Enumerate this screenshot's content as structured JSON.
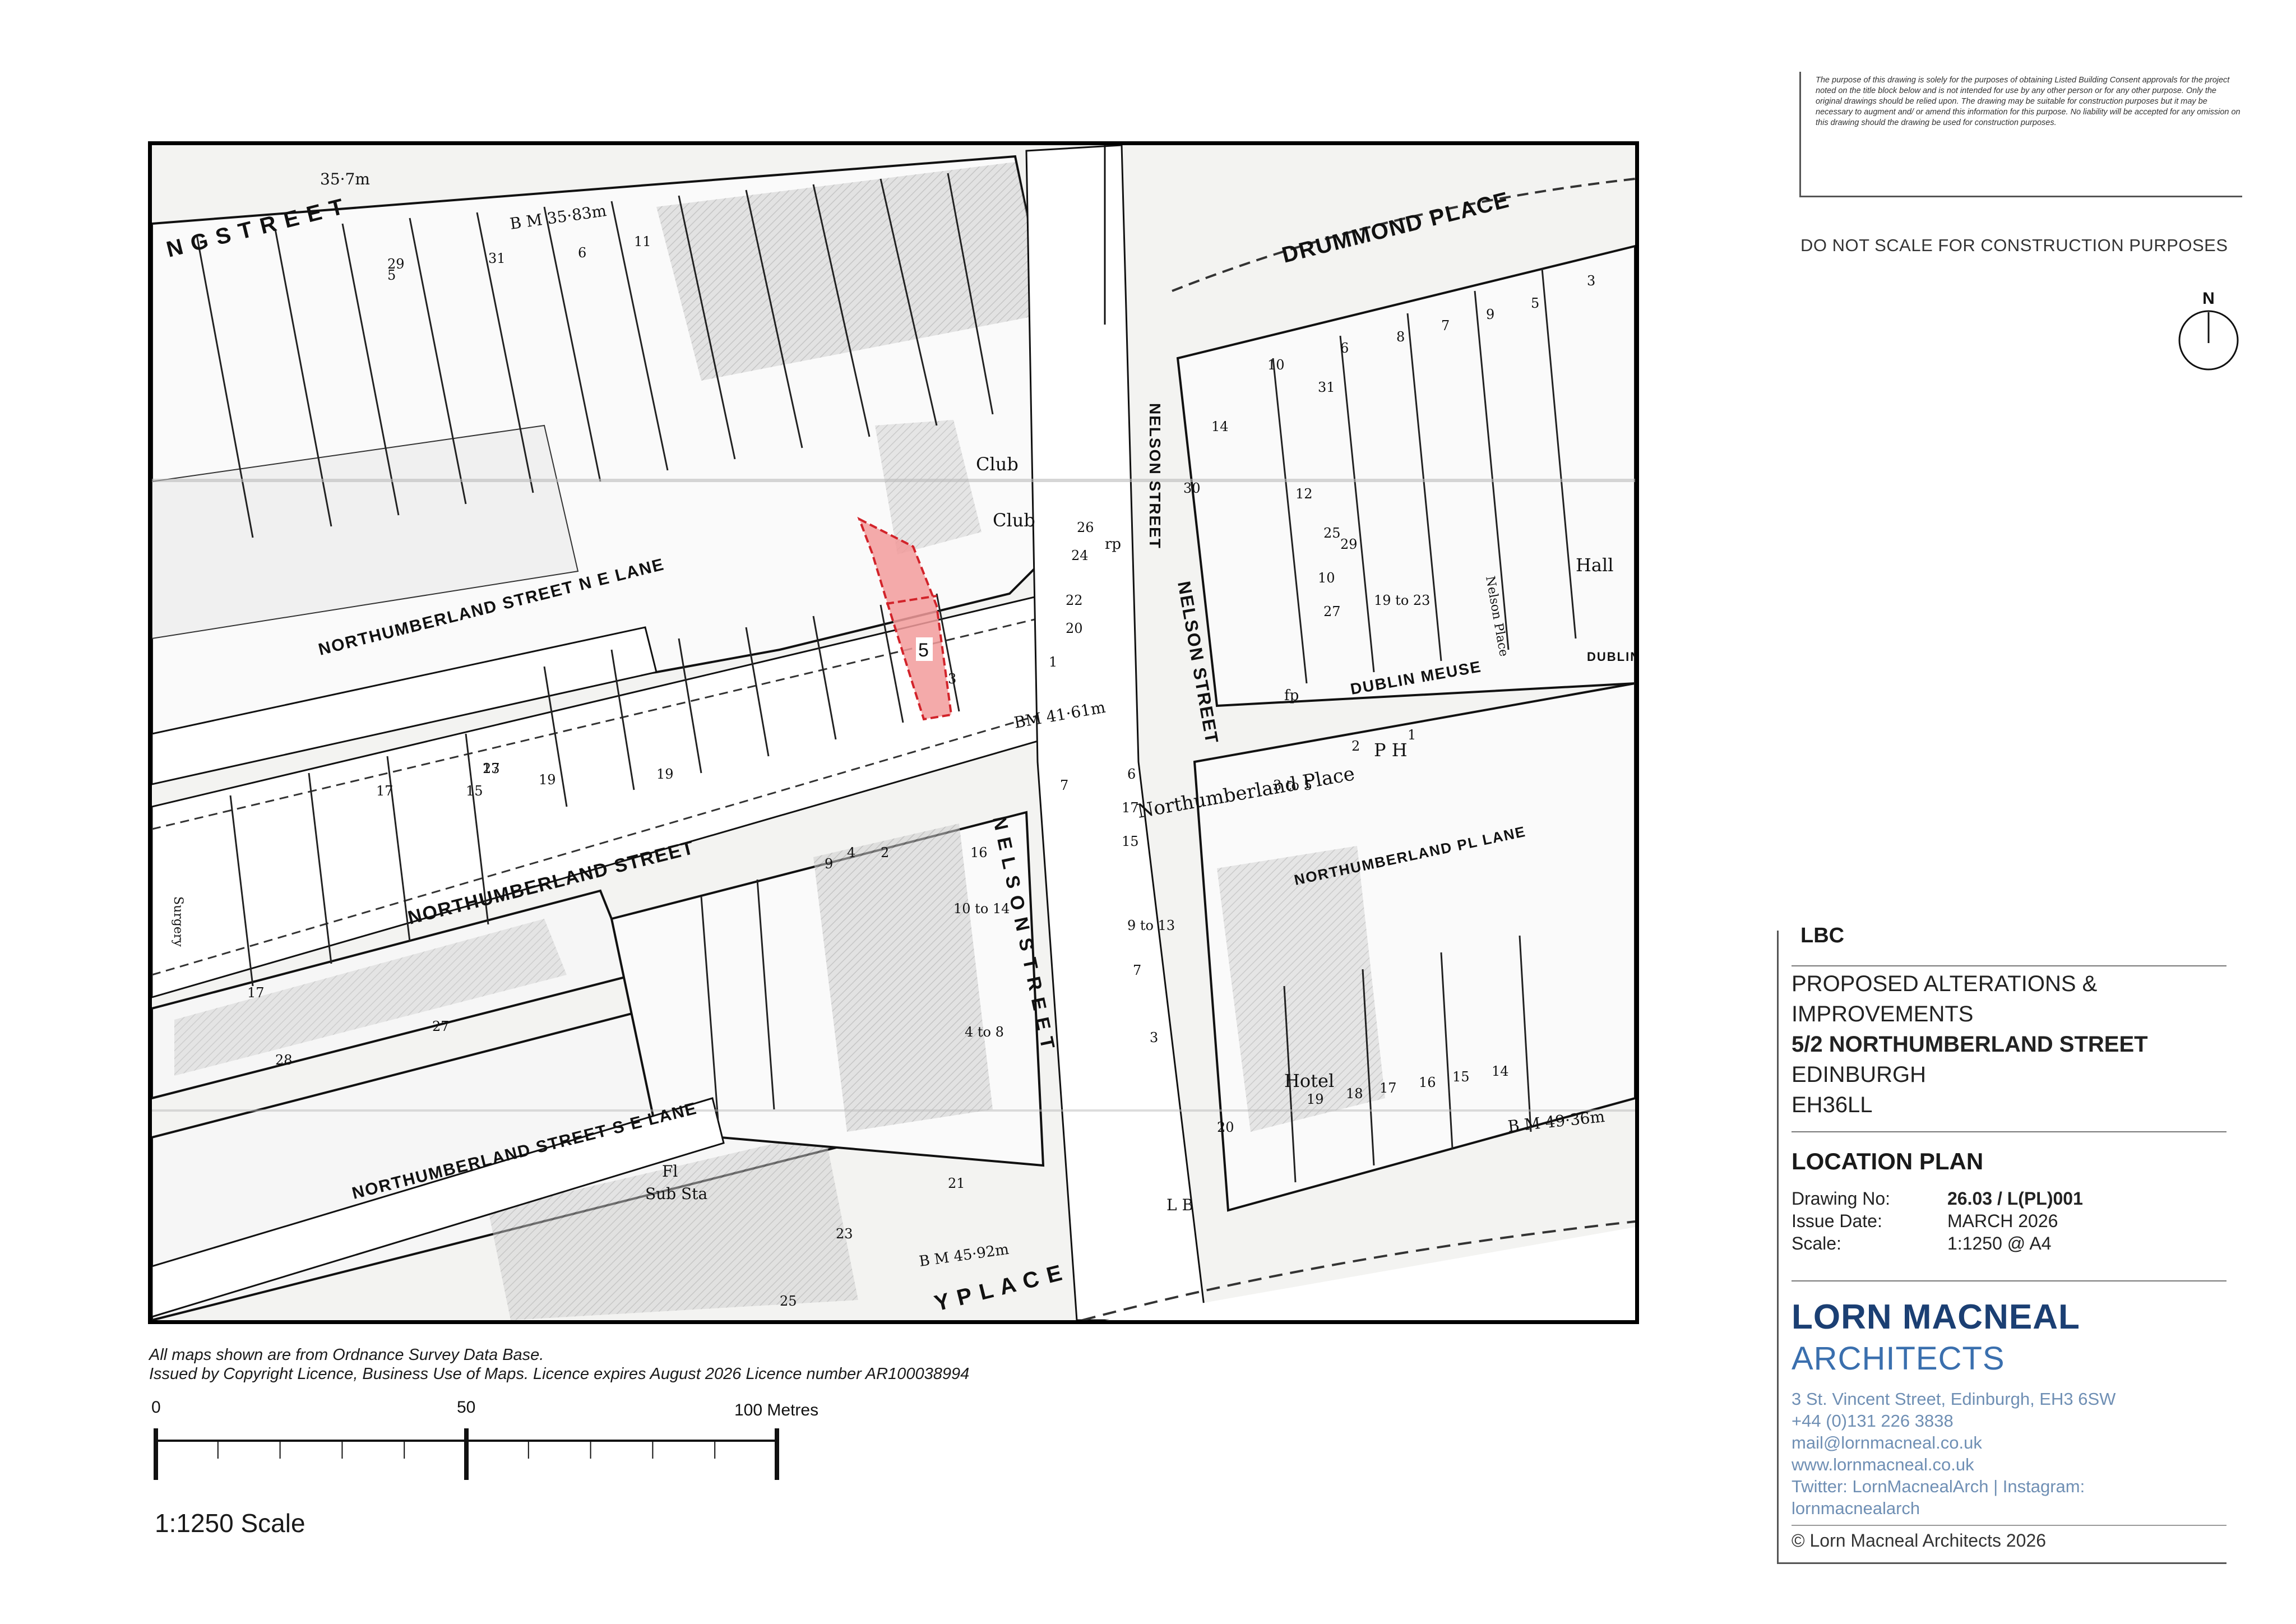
{
  "disclaimer": "The purpose of this drawing is solely for the purposes of obtaining Listed Building Consent approvals for the project noted on the title block below and is not intended for use by any other person or for any other purpose. Only the original drawings should be relied upon. The drawing may be suitable for construction purposes but it may be necessary to augment and/ or amend this information for this purpose. No liability will be accepted for any omission on this drawing should the drawing be used for construction purposes.",
  "no_scale_note": "DO NOT SCALE FOR CONSTRUCTION PURPOSES",
  "north_label": "N",
  "title_block": {
    "submission": "LBC",
    "project_lines": [
      "PROPOSED ALTERATIONS &",
      "IMPROVEMENTS"
    ],
    "address_bold": "5/2 NORTHUMBERLAND STREET",
    "address_lines": [
      "EDINBURGH",
      "EH36LL"
    ],
    "drawing_title": "LOCATION PLAN",
    "meta": [
      {
        "label": "Drawing No:",
        "value": "26.03 / L(PL)001"
      },
      {
        "label": "Issue Date:",
        "value": "MARCH 2026"
      },
      {
        "label": "Scale:",
        "value": "1:1250 @ A4"
      }
    ],
    "firm_name_1": "LORN MACNEAL",
    "firm_name_2": "ARCHITECTS",
    "contact": [
      "3 St. Vincent Street, Edinburgh, EH3 6SW",
      "+44 (0)131 226 3838",
      "mail@lornmacneal.co.uk",
      "www.lornmacneal.co.uk",
      "Twitter: LornMacnealArch | Instagram:",
      "lornmacnealarch"
    ],
    "copyright": "© Lorn Macneal Architects 2026",
    "firm_color": "#1b3f73",
    "firm_color_light": "#3a6fae"
  },
  "map_note": [
    "All maps shown are from Ordnance Survey Data Base.",
    "Issued by Copyright Licence, Business Use of Maps. Licence expires August 2026 Licence number AR100038994"
  ],
  "scale_bar": {
    "labels": [
      "0",
      "50",
      "100 Metres"
    ],
    "caption": "1:1250 Scale"
  },
  "map": {
    "site_number": "5",
    "site_color": "#f29b9b",
    "streets": {
      "northumberland_street": "NORTHUMBERLAND STREET",
      "northumberland_ne_lane": "NORTHUMBERLAND STREET N E LANE",
      "northumberland_se_lane": "NORTHUMBERLAND STREET S E LANE",
      "nelson_street": "NELSON STREET",
      "nelson_street_north": "NELSON STREET",
      "nelson_street_south": "N E L S O N   S T R E E T",
      "drummond_place": "DRUMMOND PLACE",
      "dublin_meuse": "DUBLIN MEUSE",
      "dublin_meuse_2": "DUBLIN MEUSE",
      "northumberland_pl_lane": "NORTHUMBERLAND PL LANE",
      "northumberland_place": "Northumberland Place",
      "nelson_place": "Nelson Place",
      "ng_street": "N G   S T R E E T",
      "y_place": "Y   P L A C E"
    },
    "annotations": {
      "bm_top": "B M 35·83m",
      "spot_top": "35·7m",
      "bm_mid": "BM 41·61m",
      "bm_right": "B M 49·36m",
      "bm_bottom": "B M 45·92m",
      "club_1": "Club",
      "club_2": "Club",
      "hall": "Hall",
      "hotel": "Hotel",
      "ph": "P H",
      "fl": "Fl",
      "sub_sta": "Sub Sta",
      "surgery": "Surgery",
      "lb": "L B",
      "fp1": "fp",
      "rp1": "rp",
      "nos": [
        "13",
        "17",
        "19",
        "27",
        "3",
        "1",
        "22",
        "20",
        "24",
        "26",
        "28",
        "30",
        "14",
        "12",
        "10",
        "29",
        "27",
        "25",
        "19 to 23",
        "31",
        "4",
        "2",
        "9",
        "10 to 14",
        "16",
        "4 to 8",
        "21",
        "23",
        "25",
        "17",
        "15",
        "9 to 13",
        "7",
        "3",
        "20",
        "19",
        "18",
        "17",
        "16",
        "15",
        "14",
        "6",
        "7",
        "3 to 5",
        "2",
        "1",
        "10",
        "6",
        "8",
        "7",
        "9",
        "5",
        "3",
        "17",
        "19",
        "15",
        "11",
        "6",
        "5",
        "31",
        "29",
        "27"
      ]
    }
  }
}
